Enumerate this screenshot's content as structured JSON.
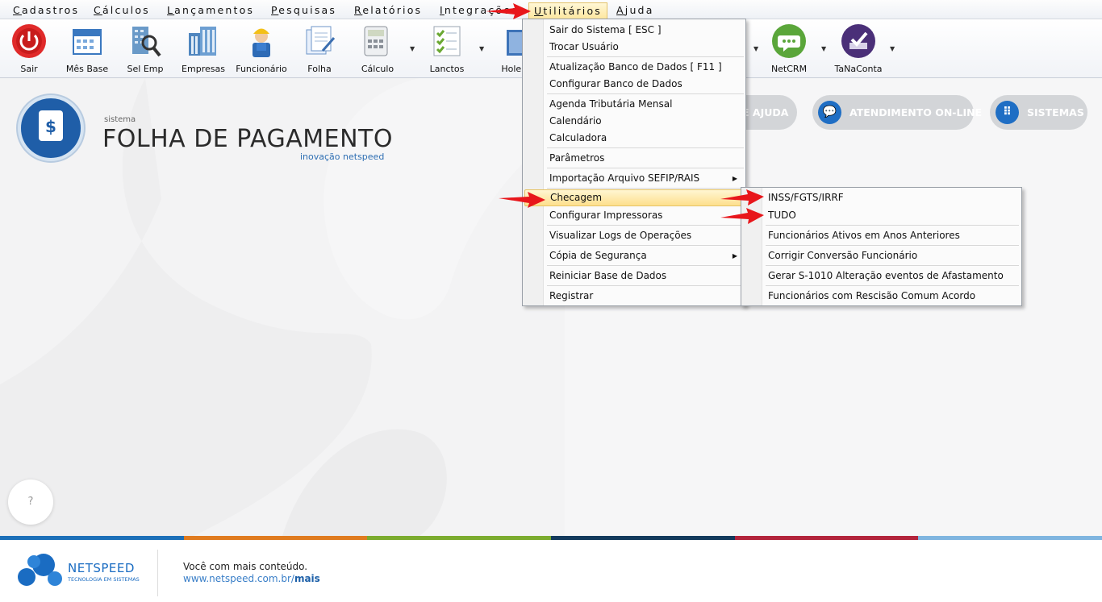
{
  "menubar": {
    "items": [
      "Cadastros",
      "Cálculos",
      "Lançamentos",
      "Pesquisas",
      "Relatórios",
      "Integrações",
      "Utilitários",
      "Ajuda"
    ]
  },
  "toolbar": {
    "buttons": [
      "Sair",
      "Mês Base",
      "Sel Emp",
      "Empresas",
      "Funcionário",
      "Folha",
      "Cálculo",
      "Lanctos",
      "Holer",
      "NetCRM",
      "TaNaConta"
    ]
  },
  "brand": {
    "small": "sistema",
    "title": "FOLHA DE PAGAMENTO",
    "tagline": "inovação netspeed"
  },
  "header_buttons": {
    "help_partial": "E AJUDA",
    "support": "ATENDIMENTO ON-LINE",
    "systems": "SISTEMAS"
  },
  "help_bubble": "?",
  "menu_utilitarios": {
    "items": [
      "Sair do Sistema [ ESC ]",
      "Trocar Usuário",
      "Atualização Banco de Dados [ F11 ]",
      "Configurar Banco de Dados",
      "Agenda Tributária Mensal",
      "Calendário",
      "Calculadora",
      "Parâmetros",
      "Importação Arquivo SEFIP/RAIS",
      "Checagem",
      "Configurar Impressoras",
      "Visualizar Logs de Operações",
      "Cópia de Segurança",
      "Reiniciar Base de Dados",
      "Registrar"
    ]
  },
  "submenu_checagem": {
    "items": [
      "INSS/FGTS/IRRF",
      "TUDO",
      "Funcionários Ativos em Anos Anteriores",
      "Corrigir Conversão Funcionário",
      "Gerar S-1010 Alteração eventos de Afastamento",
      "Funcionários com Rescisão Comum Acordo"
    ]
  },
  "footer": {
    "brand": "NETSPEED",
    "brand_tag": "TECNOLOGIA EM SISTEMAS",
    "line1": "Você com mais conteúdo.",
    "url_prefix": "www.netspeed.com.br/",
    "url_suffix": "mais"
  },
  "colors": {
    "stripe": [
      "#1c6fb8",
      "#e07b1f",
      "#7bab2e",
      "#133a5c",
      "#b3243c",
      "#7fb5e0"
    ],
    "accent_blue": "#1f6ec4",
    "highlight": "#fddf8c",
    "arrow_red": "#e8161b"
  }
}
